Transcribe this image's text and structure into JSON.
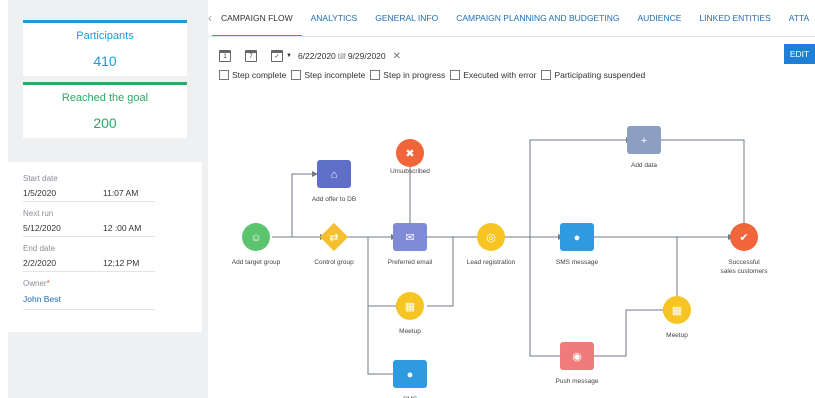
{
  "kpis": {
    "participants": {
      "label": "Participants",
      "value": "410"
    },
    "reached_goal": {
      "label": "Reached the goal",
      "value": "200"
    }
  },
  "info": {
    "start_date_label": "Start date",
    "start_date": "1/5/2020",
    "start_time": "11:07 AM",
    "next_run_label": "Next run",
    "next_run_date": "5/12/2020",
    "next_run_time": "12 :00 AM",
    "end_date_label": "End date",
    "end_date": "2/2/2020",
    "end_time": "12:12 PM",
    "owner_label": "Owner",
    "owner_value": "John Best"
  },
  "tabs": [
    "Campaign flow",
    "Analytics",
    "General info",
    "Campaign planning and budgeting",
    "Audience",
    "Linked entities",
    "Atta"
  ],
  "toolbar": {
    "date_from": "6/22/2020",
    "till": "till",
    "date_to": "9/29/2020",
    "edit_label": "EDIT"
  },
  "filters": [
    "Step complete",
    "Step incomplete",
    "Step in progress",
    "Executed with error",
    "Participating suspended"
  ],
  "flow": {
    "nodes": [
      {
        "label": "Add target group",
        "icon": "target-group-icon",
        "color": "#5cc36f"
      },
      {
        "label": "Add offer to DB",
        "icon": "offer-icon",
        "color": "#5f6fc9"
      },
      {
        "label": "Control group",
        "icon": "shuffle-icon",
        "color": "#f5c02f"
      },
      {
        "label": "Unsubscribed",
        "icon": "unsubscribed-icon",
        "color": "#f0663a"
      },
      {
        "label": "Preferred email",
        "icon": "email-icon",
        "color": "#7f8bd6"
      },
      {
        "label": "Meetup",
        "icon": "calendar-icon",
        "color": "#f6c423"
      },
      {
        "label": "SMS",
        "icon": "sms-icon",
        "color": "#2e9be0"
      },
      {
        "label": "Lead registration",
        "icon": "target-icon",
        "color": "#f6c423"
      },
      {
        "label": "Add data",
        "icon": "add-data-icon",
        "color": "#8c9ec2"
      },
      {
        "label": "SMS message",
        "icon": "sms-icon",
        "color": "#2e9be0"
      },
      {
        "label": "Push message",
        "icon": "push-message-icon",
        "color": "#ef7b7b"
      },
      {
        "label": "Meetup",
        "icon": "calendar-icon",
        "color": "#f6c423"
      },
      {
        "label": "Successful\nsales customers",
        "icon": "success-icon",
        "color": "#f0663a"
      }
    ]
  }
}
